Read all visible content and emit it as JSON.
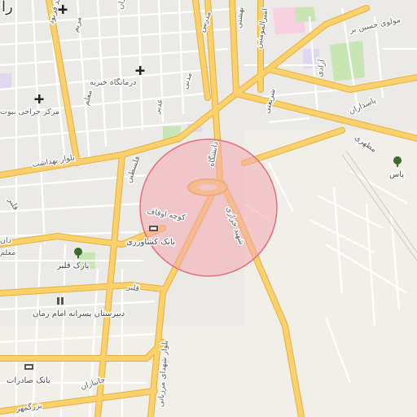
{
  "map": {
    "colors": {
      "land": "#f2efe9",
      "major_road": "#fcd06a",
      "major_road_casing": "#e3b13c",
      "minor_road": "#ffffff",
      "park": "#c8e6b4",
      "hospital": "#f7d1e0",
      "highlight_fill": "#f4a7b0",
      "highlight_stroke": "#e0707d"
    },
    "highlight": {
      "shape": "circle"
    },
    "labels": {
      "corner_partial": "را",
      "maidan": "میدان",
      "moalem": "معلم",
      "maryam": "مریم",
      "darmangah": "درمانگاه خیریه",
      "shahid_farnoud": "شهید فرنود",
      "markaz_jarahi": "مرکز جراحی نبوت",
      "maydan_3": "مدرس",
      "ghadir": "غدیر",
      "boulevard_behdasht": "بلوار بهداشت",
      "felestin": "فلسطین",
      "ghalbar": "قلبر",
      "dan": "دان",
      "park_ghalbar": "پارک قلبر",
      "bank_keshavarzi": "بانک کشاورزی",
      "koocheh_oghaf": "کوچه اوقاف",
      "dabirestan": "دبیرستان پسرانه امام زمان",
      "bank_saderat": "بانک صادرات",
      "jananzan": "جانبازان",
      "bozorgmehr": "بزرگمهر",
      "boulevard_shohada": "بلوار شهدای مرزبانی",
      "shahid_kharazi": "شهید خرازی",
      "shariati": "شریعتی",
      "pasdaran": "پاسداران",
      "motahari": "مطهری",
      "azadi": "آزادی",
      "amiralmomenin": "امیرالمومنین",
      "bahshti": "بهشتی",
      "molavi_hossein": "مولوی حسین بر",
      "daneshgah": "دانشگاه",
      "pas": "پاس",
      "modares": "مدرس",
      "madani": "مدنی",
      "moalem_mid": "معلم"
    }
  }
}
